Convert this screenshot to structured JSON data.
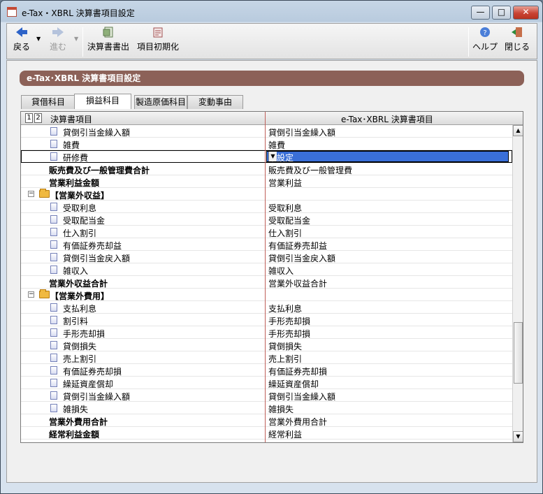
{
  "window": {
    "title": "e-Tax・XBRL 決算書項目設定"
  },
  "window_controls": {
    "minimize": "—",
    "maximize": "□",
    "close": "✕"
  },
  "toolbar": {
    "back": "戻る",
    "forward": "進む",
    "output": "決算書書出",
    "init": "項目初期化",
    "help": "ヘルプ",
    "close": "閉じる"
  },
  "panel": {
    "title": "e-Tax･XBRL 決算書項目設定"
  },
  "tabs": [
    "貸借科目",
    "損益科目",
    "製造原価科目",
    "変動事由"
  ],
  "grid": {
    "levels": [
      "1",
      "2"
    ],
    "col1": "決算書項目",
    "col2": "e-Tax･XBRL 決算書項目",
    "rows": [
      {
        "label": "貸倒引当金繰入額",
        "value": "貸倒引当金繰入額",
        "type": "doc"
      },
      {
        "label": "雑費",
        "value": "雑費",
        "type": "doc"
      },
      {
        "label": "研修費",
        "value": "未設定",
        "type": "doc",
        "selected": true
      },
      {
        "label": "販売費及び一般管理費合計",
        "value": "販売費及び一般管理費",
        "type": "total"
      },
      {
        "label": "営業利益金額",
        "value": "営業利益",
        "type": "total"
      },
      {
        "label": "【営業外収益】",
        "value": "",
        "type": "group"
      },
      {
        "label": "受取利息",
        "value": "受取利息",
        "type": "doc"
      },
      {
        "label": "受取配当金",
        "value": "受取配当金",
        "type": "doc"
      },
      {
        "label": "仕入割引",
        "value": "仕入割引",
        "type": "doc"
      },
      {
        "label": "有価証券売却益",
        "value": "有価証券売却益",
        "type": "doc"
      },
      {
        "label": "貸倒引当金戻入額",
        "value": "貸倒引当金戻入額",
        "type": "doc"
      },
      {
        "label": "雑収入",
        "value": "雑収入",
        "type": "doc"
      },
      {
        "label": "営業外収益合計",
        "value": "営業外収益合計",
        "type": "total"
      },
      {
        "label": "【営業外費用】",
        "value": "",
        "type": "group"
      },
      {
        "label": "支払利息",
        "value": "支払利息",
        "type": "doc"
      },
      {
        "label": "割引料",
        "value": "手形売却損",
        "type": "doc"
      },
      {
        "label": "手形売却損",
        "value": "手形売却損",
        "type": "doc"
      },
      {
        "label": "貸倒損失",
        "value": "貸倒損失",
        "type": "doc"
      },
      {
        "label": "売上割引",
        "value": "売上割引",
        "type": "doc"
      },
      {
        "label": "有価証券売却損",
        "value": "有価証券売却損",
        "type": "doc"
      },
      {
        "label": "繰延資産償却",
        "value": "繰延資産償却",
        "type": "doc"
      },
      {
        "label": "貸倒引当金繰入額",
        "value": "貸倒引当金繰入額",
        "type": "doc"
      },
      {
        "label": "雑損失",
        "value": "雑損失",
        "type": "doc"
      },
      {
        "label": "営業外費用合計",
        "value": "営業外費用合計",
        "type": "total"
      },
      {
        "label": "経常利益金額",
        "value": "経常利益",
        "type": "total"
      }
    ]
  },
  "scrollbar": {
    "up": "▲",
    "down": "▼"
  },
  "select_arrow": "▼",
  "expander": "−",
  "colors": {
    "panel_title": "#8c6158",
    "selection": "#3a6fd8",
    "column_divider": "#c0605a"
  }
}
